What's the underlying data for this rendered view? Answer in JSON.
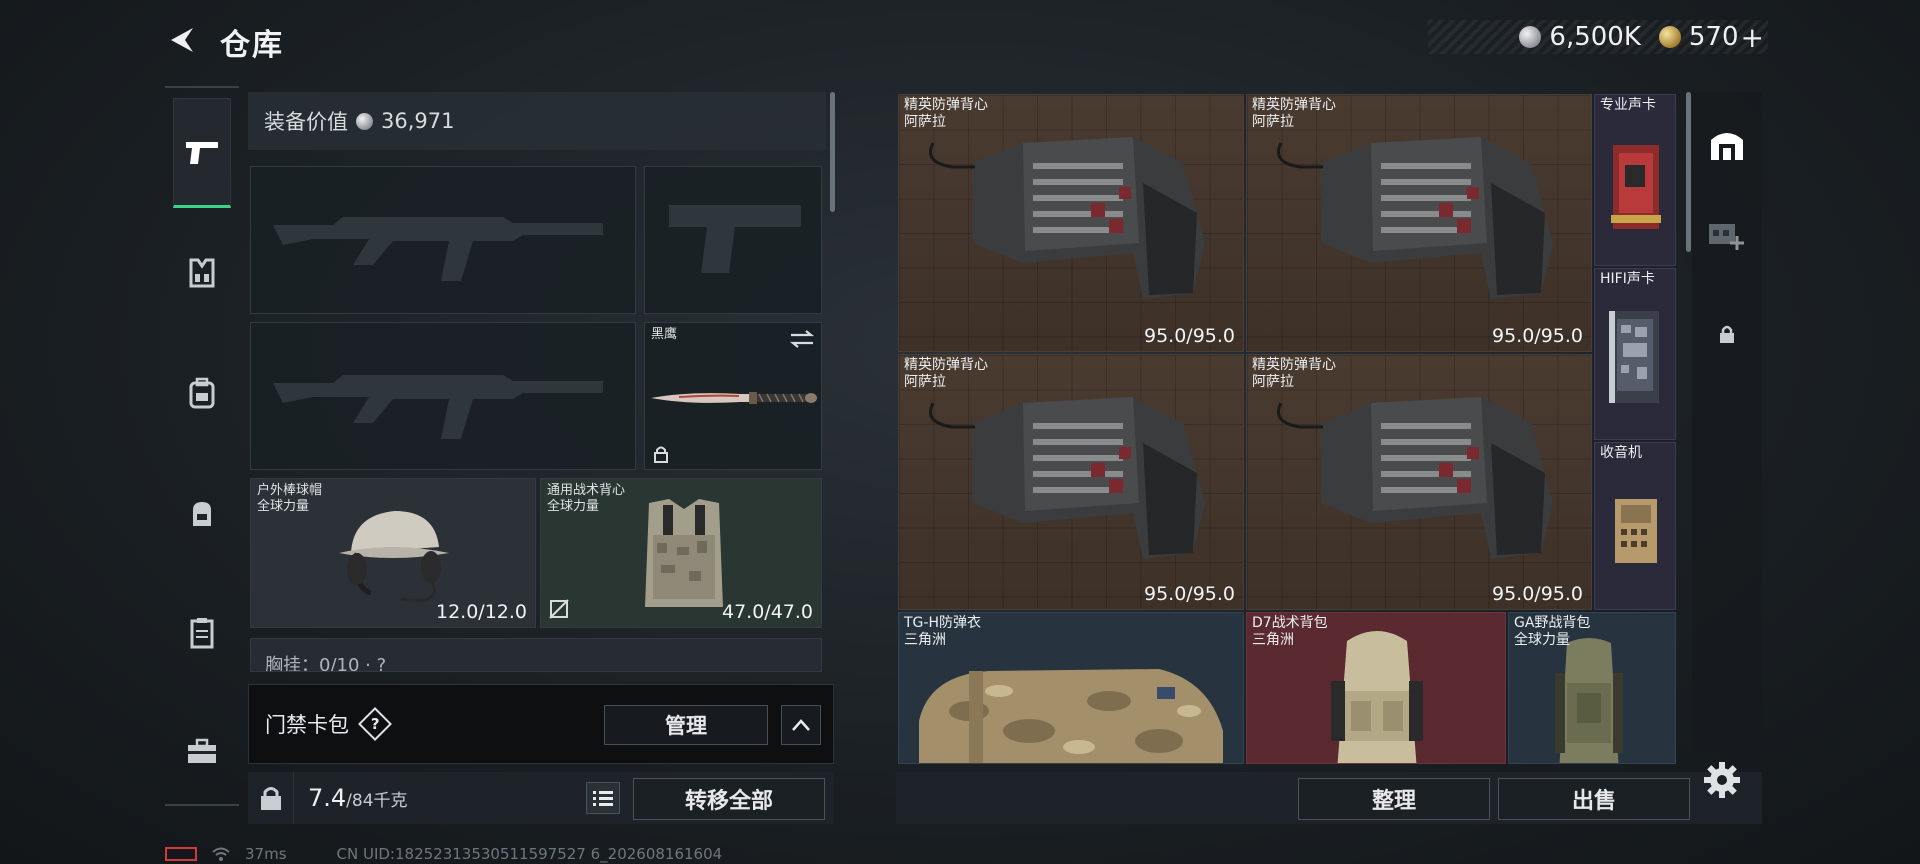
{
  "header": {
    "title": "仓库",
    "silver_amount": "6,500K",
    "gold_amount": "570",
    "plus_label": "+"
  },
  "rail": {
    "items": [
      "pistol-icon",
      "vest-icon",
      "backpack-icon",
      "chest-rig-icon",
      "case-icon",
      "toolbox-icon"
    ],
    "active": 0
  },
  "equipment": {
    "value_label": "装备价值",
    "value_amount": "36,971",
    "melee": {
      "name": "黑鹰"
    },
    "helmet": {
      "name": "户外棒球帽",
      "source": "全球力量",
      "durability": "12.0/12.0"
    },
    "armor": {
      "name": "通用战术背心",
      "source": "全球力量",
      "durability": "47.0/47.0"
    },
    "chest_peek": "胸挂：0/10 · ?"
  },
  "cardpack": {
    "label": "门禁卡包",
    "help": "?",
    "manage_label": "管理"
  },
  "weight": {
    "current": "7.4",
    "max": "/84千克",
    "transfer_label": "转移全部"
  },
  "storage": {
    "items": [
      {
        "name": "精英防弹背心",
        "source": "阿萨拉",
        "durability": "95.0/95.0"
      },
      {
        "name": "精英防弹背心",
        "source": "阿萨拉",
        "durability": "95.0/95.0"
      },
      {
        "name": "精英防弹背心",
        "source": "阿萨拉",
        "durability": "95.0/95.0"
      },
      {
        "name": "精英防弹背心",
        "source": "阿萨拉",
        "durability": "95.0/95.0"
      },
      {
        "name": "专业声卡",
        "source": ""
      },
      {
        "name": "HIFI声卡",
        "source": ""
      },
      {
        "name": "收音机",
        "source": ""
      },
      {
        "name": "TG-H防弹衣",
        "source": "三角洲"
      },
      {
        "name": "D7战术背包",
        "source": "三角洲"
      },
      {
        "name": "GA野战背包",
        "source": "全球力量"
      }
    ],
    "sort_label": "整理",
    "sell_label": "出售"
  },
  "status": {
    "ping": "37ms",
    "uid": "CN UID:18252313530511597527 6_202608161604"
  },
  "colors": {
    "accent_green": "#3fd38a",
    "brown_cell": "#4a3b30",
    "red_cell": "#5a2a30"
  }
}
